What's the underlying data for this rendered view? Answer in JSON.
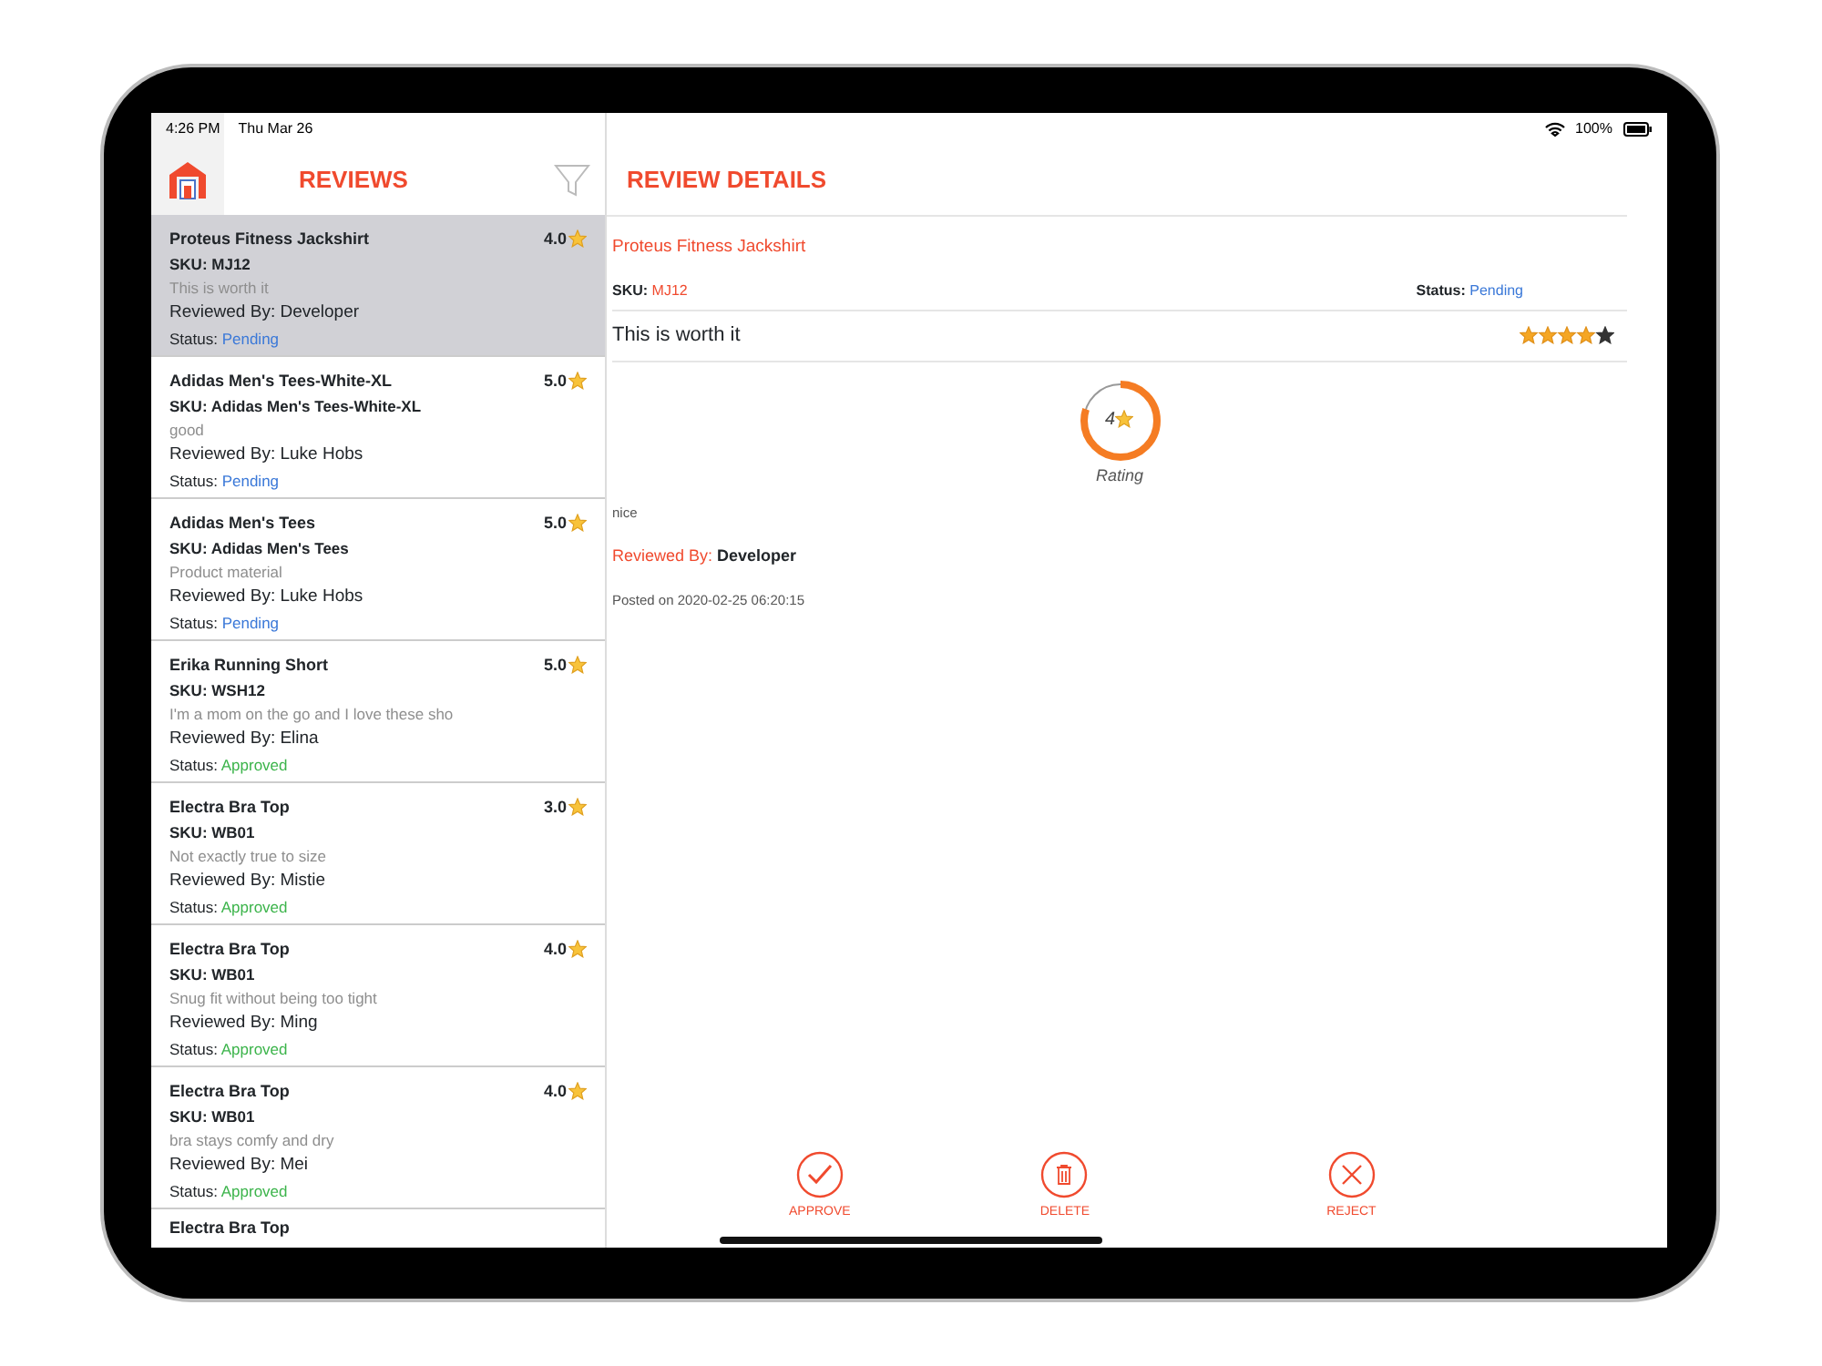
{
  "status_bar": {
    "time": "4:26 PM",
    "date": "Thu Mar 26",
    "battery": "100%"
  },
  "list_panel": {
    "title": "REVIEWS"
  },
  "reviews": [
    {
      "product": "Proteus Fitness Jackshirt",
      "sku": "SKU: MJ12",
      "comment": "This is worth it",
      "reviewer": "Reviewed By: Developer",
      "status_label": "Status:",
      "status": "Pending",
      "color": "#3a78d8",
      "rating": "4.0",
      "selected": true
    },
    {
      "product": "Adidas Men's Tees-White-XL",
      "sku": "SKU: Adidas Men's Tees-White-XL",
      "comment": "good",
      "reviewer": "Reviewed By: Luke Hobs",
      "status_label": "Status:",
      "status": "Pending",
      "color": "#3a78d8",
      "rating": "5.0",
      "selected": false
    },
    {
      "product": "Adidas Men's Tees",
      "sku": "SKU: Adidas Men's Tees",
      "comment": "Product material",
      "reviewer": "Reviewed By: Luke Hobs",
      "status_label": "Status:",
      "status": "Pending",
      "color": "#3a78d8",
      "rating": "5.0",
      "selected": false
    },
    {
      "product": "Erika Running Short",
      "sku": "SKU: WSH12",
      "comment": "I'm a mom on the go and I love these sho",
      "reviewer": "Reviewed By: Elina",
      "status_label": "Status:",
      "status": "Approved",
      "color": "#3cb44b",
      "rating": "5.0",
      "selected": false
    },
    {
      "product": "Electra Bra Top",
      "sku": "SKU: WB01",
      "comment": "Not exactly true to size",
      "reviewer": "Reviewed By: Mistie",
      "status_label": "Status:",
      "status": "Approved",
      "color": "#3cb44b",
      "rating": "3.0",
      "selected": false
    },
    {
      "product": "Electra Bra Top",
      "sku": "SKU: WB01",
      "comment": "Snug fit without being too tight",
      "reviewer": "Reviewed By: Ming",
      "status_label": "Status:",
      "status": "Approved",
      "color": "#3cb44b",
      "rating": "4.0",
      "selected": false
    },
    {
      "product": "Electra Bra Top",
      "sku": "SKU: WB01",
      "comment": "bra stays comfy and dry",
      "reviewer": "Reviewed By: Mei",
      "status_label": "Status:",
      "status": "Approved",
      "color": "#3cb44b",
      "rating": "4.0",
      "selected": false
    },
    {
      "product": "Electra Bra Top",
      "selected": false
    }
  ],
  "detail": {
    "title": "REVIEW DETAILS",
    "product": "Proteus Fitness Jackshirt",
    "sku_label": "SKU:",
    "sku": "MJ12",
    "status_label": "Status:",
    "status": "Pending",
    "color": "#3a78d8",
    "comment": "This is worth it",
    "stars": 4,
    "rating": {
      "value": "4",
      "level": 0.8,
      "caption": "Rating"
    },
    "detail_text": "nice",
    "reviewed_by_label": "Reviewed By:",
    "reviewer": "Developer",
    "posted": "Posted on 2020-02-25 06:20:15"
  },
  "actions": [
    {
      "label": "APPROVE",
      "kind": "approve"
    },
    {
      "label": "DELETE",
      "kind": "delete"
    },
    {
      "label": "REJECT",
      "kind": "reject"
    }
  ]
}
